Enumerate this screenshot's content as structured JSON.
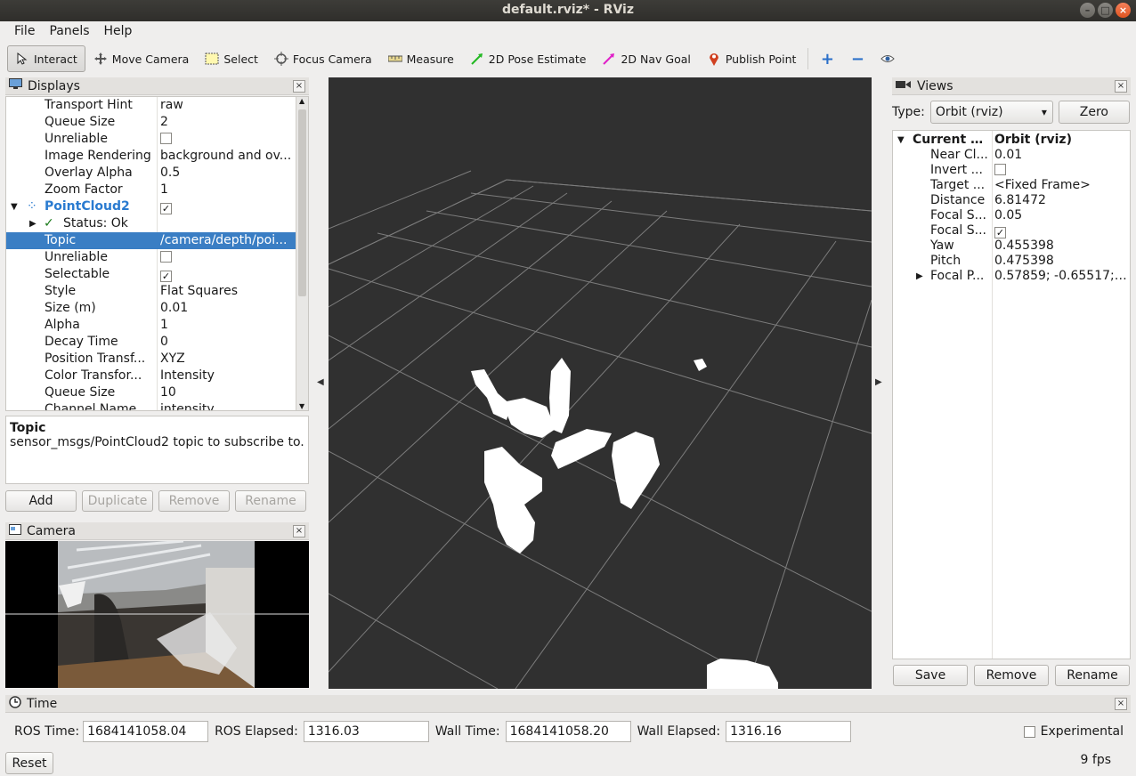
{
  "window": {
    "title": "default.rviz* - RViz"
  },
  "menu": [
    "File",
    "Panels",
    "Help"
  ],
  "toolbar": {
    "tools": [
      {
        "label": "Interact",
        "icon": "cursor-icon",
        "active": true
      },
      {
        "label": "Move Camera",
        "icon": "move-camera-icon"
      },
      {
        "label": "Select",
        "icon": "select-box-icon"
      },
      {
        "label": "Focus Camera",
        "icon": "focus-camera-icon"
      },
      {
        "label": "Measure",
        "icon": "ruler-icon"
      },
      {
        "label": "2D Pose Estimate",
        "icon": "green-arrow-icon"
      },
      {
        "label": "2D Nav Goal",
        "icon": "magenta-arrow-icon"
      },
      {
        "label": "Publish Point",
        "icon": "map-pin-icon"
      }
    ]
  },
  "displays": {
    "title": "Displays",
    "rows": [
      {
        "key": "Transport Hint",
        "value": "raw"
      },
      {
        "key": "Queue Size",
        "value": "2"
      },
      {
        "key": "Unreliable",
        "value": "",
        "checkbox": false
      },
      {
        "key": "Image Rendering",
        "value": "background and ov..."
      },
      {
        "key": "Overlay Alpha",
        "value": "0.5"
      },
      {
        "key": "Zoom Factor",
        "value": "1"
      },
      {
        "key": "PointCloud2",
        "value": "",
        "checkbox": true,
        "group": true
      },
      {
        "key": "Status: Ok",
        "value": "",
        "status": true
      },
      {
        "key": "Topic",
        "value": "/camera/depth/poi...",
        "selected": true
      },
      {
        "key": "Unreliable",
        "value": "",
        "checkbox": false
      },
      {
        "key": "Selectable",
        "value": "",
        "checkbox": true
      },
      {
        "key": "Style",
        "value": "Flat Squares"
      },
      {
        "key": "Size (m)",
        "value": "0.01"
      },
      {
        "key": "Alpha",
        "value": "1"
      },
      {
        "key": "Decay Time",
        "value": "0"
      },
      {
        "key": "Position Transf...",
        "value": "XYZ"
      },
      {
        "key": "Color Transfor...",
        "value": "Intensity"
      },
      {
        "key": "Queue Size",
        "value": "10"
      },
      {
        "key": "Channel Name",
        "value": "intensity"
      }
    ],
    "description_title": "Topic",
    "description_text": "sensor_msgs/PointCloud2 topic to subscribe to.",
    "buttons": {
      "add": "Add",
      "duplicate": "Duplicate",
      "remove": "Remove",
      "rename": "Rename"
    }
  },
  "camera": {
    "title": "Camera"
  },
  "views": {
    "title": "Views",
    "type_label": "Type:",
    "type_value": "Orbit (rviz)",
    "zero": "Zero",
    "rows": [
      {
        "key": "Current V...",
        "value": "Orbit (rviz)",
        "bold": true
      },
      {
        "key": "Near Cl...",
        "value": "0.01"
      },
      {
        "key": "Invert ...",
        "value": "",
        "checkbox": false
      },
      {
        "key": "Target ...",
        "value": "<Fixed Frame>"
      },
      {
        "key": "Distance",
        "value": "6.81472"
      },
      {
        "key": "Focal S...",
        "value": "0.05"
      },
      {
        "key": "Focal S...",
        "value": "",
        "checkbox": true
      },
      {
        "key": "Yaw",
        "value": "0.455398"
      },
      {
        "key": "Pitch",
        "value": "0.475398"
      },
      {
        "key": "Focal P...",
        "value": "0.57859; -0.65517; -..."
      }
    ],
    "buttons": {
      "save": "Save",
      "remove": "Remove",
      "rename": "Rename"
    }
  },
  "time": {
    "title": "Time",
    "ros_time_label": "ROS Time:",
    "ros_time": "1684141058.04",
    "ros_elapsed_label": "ROS Elapsed:",
    "ros_elapsed": "1316.03",
    "wall_time_label": "Wall Time:",
    "wall_time": "1684141058.20",
    "wall_elapsed_label": "Wall Elapsed:",
    "wall_elapsed": "1316.16",
    "experimental": "Experimental",
    "reset": "Reset",
    "fps": "9 fps"
  }
}
